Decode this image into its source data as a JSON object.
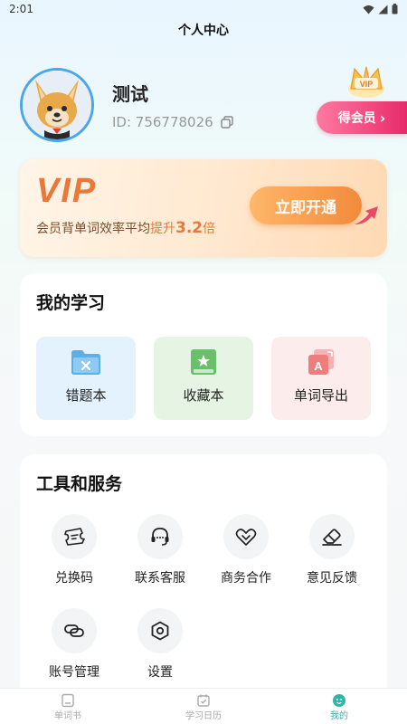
{
  "status_bar": {
    "time": "2:01"
  },
  "header": {
    "title": "个人中心"
  },
  "profile": {
    "name": "测试",
    "id_text": "ID: 756778026"
  },
  "vip_badge": {
    "text": "VIP"
  },
  "get_member": {
    "label": "得会员",
    "chevron": "›"
  },
  "vip_banner": {
    "title": "VIP",
    "desc_prefix": "会员背单词效率平均",
    "desc_highlight": "提升",
    "desc_value": "3.2",
    "desc_suffix": "倍",
    "button_label": "立即开通"
  },
  "study": {
    "title": "我的学习",
    "items": [
      {
        "label": "错题本",
        "icon": "error-folder-icon"
      },
      {
        "label": "收藏本",
        "icon": "bookmark-book-icon"
      },
      {
        "label": "单词导出",
        "icon": "word-export-icon"
      }
    ]
  },
  "tools": {
    "title": "工具和服务",
    "items": [
      {
        "label": "兑换码",
        "icon": "ticket-icon"
      },
      {
        "label": "联系客服",
        "icon": "headset-icon"
      },
      {
        "label": "商务合作",
        "icon": "handshake-icon"
      },
      {
        "label": "意见反馈",
        "icon": "eraser-icon"
      },
      {
        "label": "账号管理",
        "icon": "link-icon"
      },
      {
        "label": "设置",
        "icon": "gear-icon"
      }
    ]
  },
  "bottom_nav": {
    "items": [
      {
        "label": "单词书",
        "icon": "book-icon",
        "active": false
      },
      {
        "label": "学习日历",
        "icon": "calendar-icon",
        "active": false
      },
      {
        "label": "我的",
        "icon": "face-icon",
        "active": true
      }
    ]
  },
  "colors": {
    "accent": "#2fb7a6",
    "vip_orange": "#e9783a",
    "member_pink": "#e72a6b",
    "avatar_border": "#4aa6e8"
  }
}
